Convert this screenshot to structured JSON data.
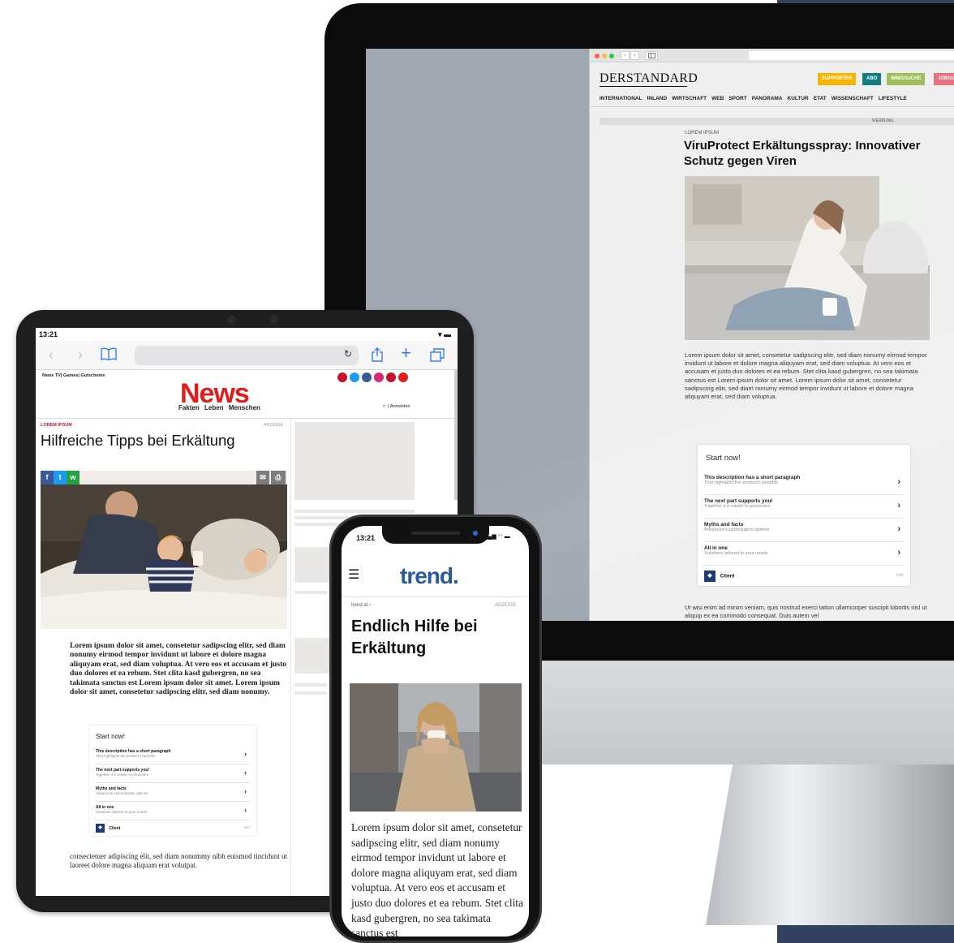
{
  "desktop": {
    "browser": {
      "nav_back": "‹",
      "nav_forward": "›",
      "sidebar_icon": "sidebar-icon"
    },
    "site": {
      "logo": "DERSTANDARD",
      "pills": [
        {
          "label": "SUPPORTER",
          "color": "#f7b500"
        },
        {
          "label": "ABO",
          "color": "#137c85"
        },
        {
          "label": "IMMOSUCHE",
          "color": "#9dc15a"
        },
        {
          "label": "JOBSU",
          "color": "#e5717c"
        }
      ],
      "nav": [
        "INTERNATIONAL",
        "INLAND",
        "WIRTSCHAFT",
        "WEB",
        "SPORT",
        "PANORAMA",
        "KULTUR",
        "ETAT",
        "WISSENSCHAFT",
        "LIFESTYLE"
      ],
      "werbung": "WERBUNG",
      "kicker": "LOREM IPSUM",
      "headline": "ViruProtect Erkältungsspray: Innovativer Schutz gegen Viren",
      "body": "Lorem ipsum dolor sit amet, consetetur sadipscing elitr, sed diam nonumy eirmod tempor invidunt ut labore et dolore magna aliquyam erat, sed diam voluptua. At vero eos et accusam et justo duo dolores et ea rebum. Stet clita kasd gubergren, no sea takimata sanctus est Lorem ipsum dolor sit amet. Lorem ipsum dolor sit amet, consetetur sadipscing elitr, sed diam nonumy eirmod tempor invidunt ut labore et dolore magna aliquyam erat, sed diam voluptua.",
      "more": "Ut wisi enim ad minim veniam, quis nostrud exerci tation ullamcorper suscipit lobortis nisl ut aliquip ex ea commodo consequat. Duis autem vel"
    }
  },
  "widget": {
    "title": "Start now!",
    "rows": [
      {
        "title": "This description has a short paragraph",
        "subtitle": "That highlights the product's benefits"
      },
      {
        "title": "The next part supports you!",
        "subtitle": "Together it is easier to persevere"
      },
      {
        "title": "Myths and facts",
        "subtitle": "Advanced customization options"
      },
      {
        "title": "All in one",
        "subtitle": "Solutions tailored to your needs"
      }
    ],
    "chevron": "›",
    "client": "Client",
    "info": "Info"
  },
  "tablet": {
    "time": "13:21",
    "site": {
      "top_links": "News TV| Games| Gutscheine",
      "logo": "News",
      "sections": "Fakten Leben Menschen",
      "login": "Anmelden",
      "social_colors": [
        "#c8102e",
        "#1d9bf0",
        "#3b5998",
        "#d62976",
        "#c8102e",
        "#e01b1b"
      ],
      "kicker": "LOREM IPSUM",
      "anzeige": "ANZEIGE",
      "headline": "Hilfreiche Tipps bei Erkältung",
      "share": [
        {
          "icon": "facebook-icon",
          "glyph": "f",
          "color": "#3b5998"
        },
        {
          "icon": "twitter-icon",
          "glyph": "t",
          "color": "#1d9bf0"
        },
        {
          "icon": "whatsapp-icon",
          "glyph": "w",
          "color": "#25a244"
        }
      ],
      "body": "Lorem ipsum dolor sit amet, consetetur sadipscing elitr, sed diam nonumy eirmod tempor invidunt ut labore et dolore magna aliquyam erat, sed diam voluptua. At vero eos et accusam et justo duo dolores et ea rebum. Stet clita kasd gubergren, no sea takimata sanctus est Lorem ipsum dolor sit amet. Lorem ipsum dolor sit amet, consetetur sadipscing elitr, sed diam nonumy.",
      "more": "consectetuer adipiscing elit, sed diam nonummy nibh euismod tincidunt ut laoreet dolore magna aliquam erat volutpat."
    }
  },
  "phone": {
    "time": "13:21",
    "site": {
      "logo": "trend.",
      "crumb": "trend.at ›",
      "anzeige": "ANZEIGE",
      "headline": "Endlich Hilfe bei Erkältung",
      "body": "Lorem ipsum dolor sit amet, consetetur sadipscing elitr, sed diam nonumy eirmod tempor invidunt ut labore et dolore magna aliquyam erat, sed diam voluptua. At vero eos et accusam et justo duo dolores et ea rebum. Stet clita kasd gubergren, no sea takimata sanctus est"
    }
  }
}
